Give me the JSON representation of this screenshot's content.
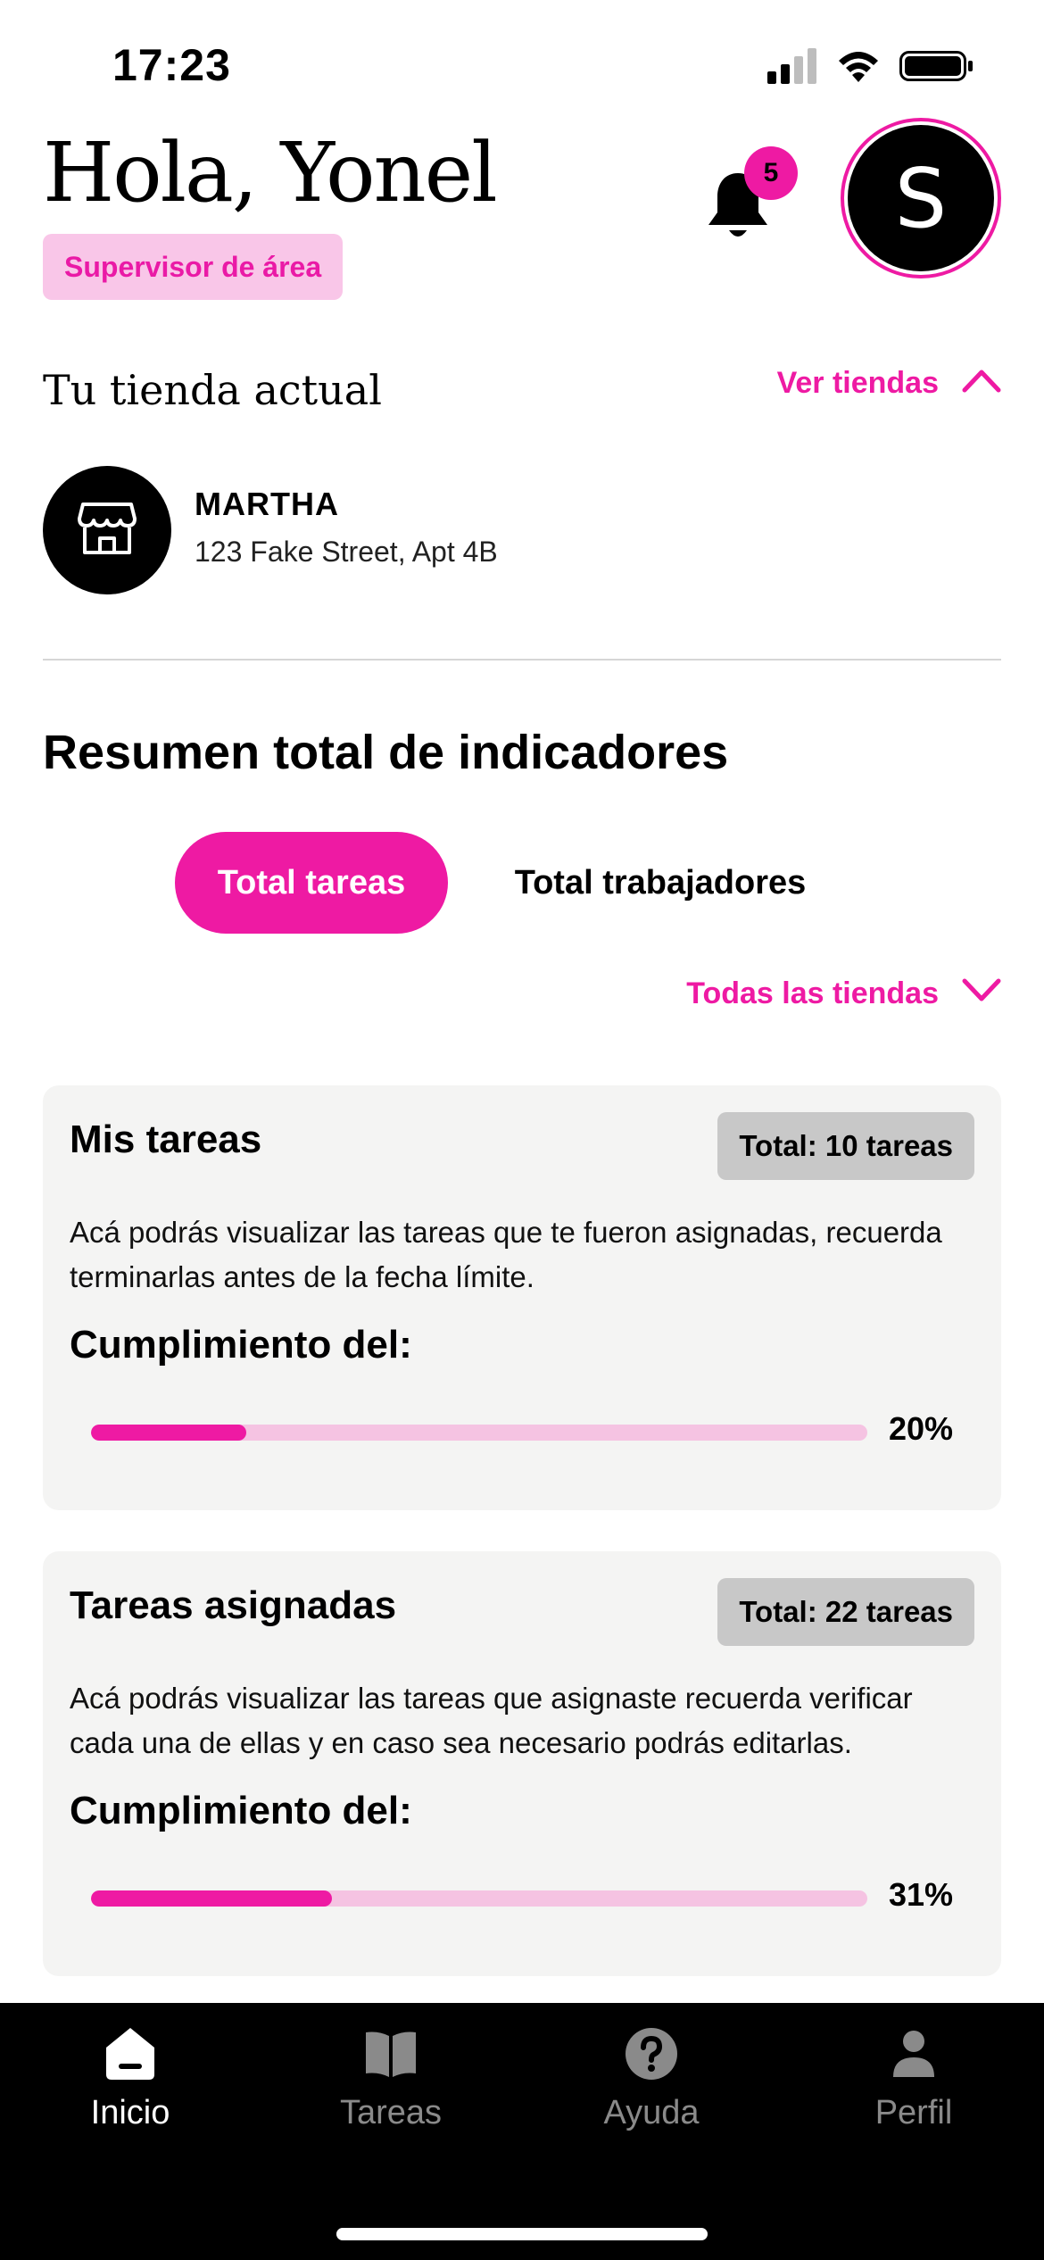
{
  "status_bar": {
    "time": "17:23"
  },
  "header": {
    "greeting": "Hola, Yonel",
    "role": "Supervisor de área",
    "notifications_count": "5",
    "avatar_initial": "S"
  },
  "store": {
    "section_title": "Tu tienda actual",
    "toggle_label": "Ver tiendas",
    "name": "MARTHA",
    "address": "123 Fake Street, Apt 4B"
  },
  "indicators": {
    "title": "Resumen total de indicadores",
    "tabs": [
      {
        "label": "Total tareas",
        "active": true
      },
      {
        "label": "Total trabajadores",
        "active": false
      }
    ],
    "filter_label": "Todas las tiendas"
  },
  "cards": [
    {
      "title": "Mis tareas",
      "total": "Total: 10 tareas",
      "description": "Acá podrás visualizar las tareas que te fueron asignadas, recuerda terminarlas antes de la fecha límite.",
      "subtitle": "Cumplimiento del:",
      "progress": 0.2,
      "progress_label": "20%"
    },
    {
      "title": "Tareas asignadas",
      "total": "Total: 22 tareas",
      "description": "Acá podrás visualizar las tareas que asignaste recuerda verificar cada una de ellas y en caso sea necesario podrás editarlas.",
      "subtitle": "Cumplimiento del:",
      "progress": 0.31,
      "progress_label": "31%"
    }
  ],
  "bottom_nav": [
    {
      "label": "Inicio",
      "icon": "home-icon",
      "active": true
    },
    {
      "label": "Tareas",
      "icon": "book-icon",
      "active": false
    },
    {
      "label": "Ayuda",
      "icon": "help-icon",
      "active": false
    },
    {
      "label": "Perfil",
      "icon": "person-icon",
      "active": false
    }
  ],
  "colors": {
    "accent": "#ee1aa3",
    "accent_light": "#f5c3e2",
    "badge_bg": "#f9c6e8",
    "card_bg": "#f4f4f3",
    "nav_bg": "#000000"
  }
}
